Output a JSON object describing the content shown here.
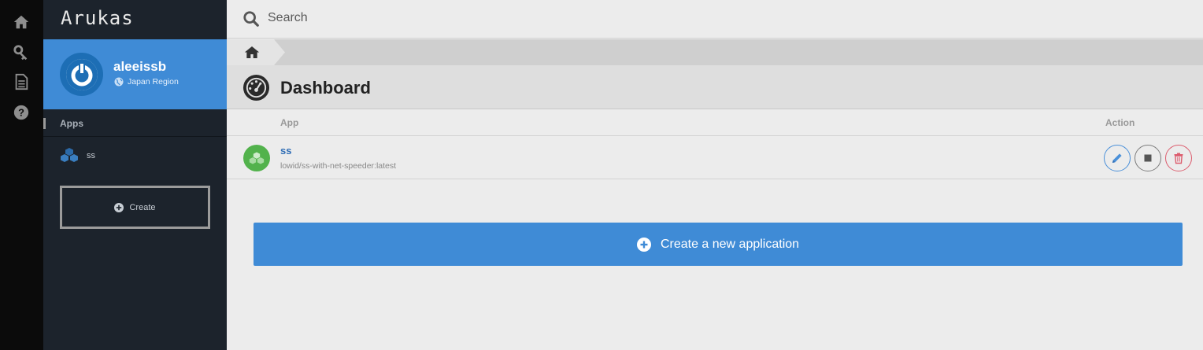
{
  "brand": {
    "logo_text": "Arukas"
  },
  "rail": {
    "items": [
      {
        "icon": "home-icon"
      },
      {
        "icon": "key-icon"
      },
      {
        "icon": "document-icon"
      },
      {
        "icon": "help-icon"
      }
    ]
  },
  "profile": {
    "username": "aleeissb",
    "region": "Japan Region"
  },
  "sidebar": {
    "apps_header": "Apps",
    "apps": [
      {
        "label": "ss"
      }
    ],
    "create_label": "Create"
  },
  "search": {
    "placeholder": "Search",
    "value": ""
  },
  "breadcrumb": {
    "icon": "home-icon"
  },
  "page": {
    "title": "Dashboard"
  },
  "table": {
    "columns": {
      "app": "App",
      "action": "Action"
    },
    "rows": [
      {
        "name": "ss",
        "image": "lowid/ss-with-net-speeder:latest",
        "actions": [
          "edit-icon",
          "stop-icon",
          "trash-icon"
        ]
      }
    ]
  },
  "cta": {
    "label": "Create a new application"
  },
  "colors": {
    "accent": "#3f8bd6",
    "sidebar": "#1c232c",
    "rail": "#0b0b0b",
    "app_status": "#52b24c",
    "danger": "#dc5d6e"
  }
}
